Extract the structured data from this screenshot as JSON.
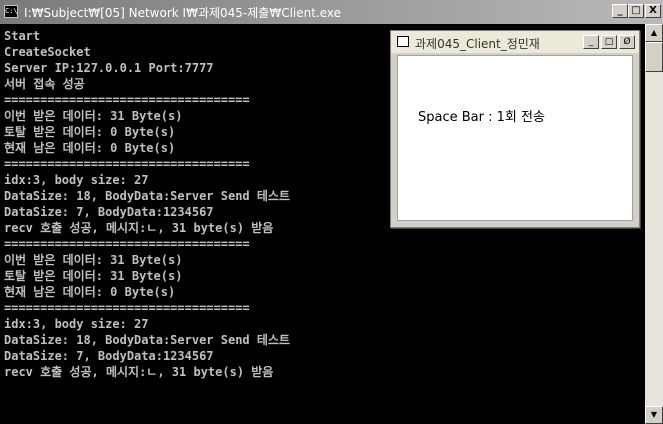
{
  "console": {
    "title": "I:₩Subject₩[05] Network I₩과제045-제출₩Client.exe",
    "icon_label": "C:\\",
    "caption_buttons": {
      "minimize": "_",
      "maximize": "□",
      "close": "X"
    },
    "lines": [
      "Start",
      "CreateSocket",
      "Server IP:127.0.0.1 Port:7777",
      "서버 접속 성공",
      "==================================",
      "이번 받은 데이터: 31 Byte(s)",
      "토탈 받은 데이터: 0 Byte(s)",
      "현재 남은 데이터: 0 Byte(s)",
      "==================================",
      "idx:3, body size: 27",
      "DataSize: 18, BodyData:Server Send 테스트",
      "DataSize: 7, BodyData:1234567",
      "recv 호출 성공, 메시지:ㄴ, 31 byte(s) 받음",
      "==================================",
      "이번 받은 데이터: 31 Byte(s)",
      "토탈 받은 데이터: 31 Byte(s)",
      "현재 남은 데이터: 0 Byte(s)",
      "==================================",
      "idx:3, body size: 27",
      "DataSize: 18, BodyData:Server Send 테스트",
      "DataSize: 7, BodyData:1234567",
      "recv 호출 성공, 메시지:ㄴ, 31 byte(s) 받음"
    ]
  },
  "scrollbar": {
    "up_arrow": "▲",
    "down_arrow": "▼"
  },
  "client_window": {
    "title": "과제045_Client_정민재",
    "caption_buttons": {
      "minimize": "_",
      "maximize": "□",
      "close": "Ø"
    },
    "status_text": "Space Bar : 1회 전송"
  },
  "colors": {
    "console_bg": "#000000",
    "console_text": "#c0c0c0"
  }
}
